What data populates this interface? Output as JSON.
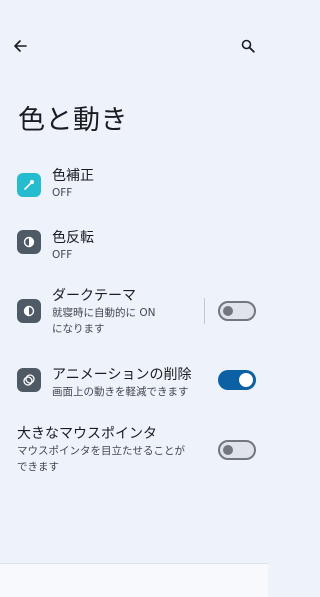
{
  "header": {
    "title": "色と動き"
  },
  "settings": [
    {
      "title": "色補正",
      "subtitle": "OFF"
    },
    {
      "title": "色反転",
      "subtitle": "OFF"
    },
    {
      "title": "ダークテーマ",
      "subtitle_line1": "就寝時に自動的に ON",
      "subtitle_line2": "になります",
      "toggle": "off"
    },
    {
      "title": "アニメーションの削除",
      "subtitle": "画面上の動きを軽減できます",
      "toggle": "on"
    },
    {
      "title": "大きなマウスポインタ",
      "subtitle_line1": "マウスポインタを目立たせることが",
      "subtitle_line2": "できます",
      "toggle": "off"
    }
  ],
  "icons": {
    "back": "arrow-back-icon",
    "search": "search-icon",
    "color_correction": "eyedropper-icon",
    "color_inversion": "invert-colors-icon",
    "dark_theme": "dark-theme-icon",
    "remove_animations": "animation-icon"
  },
  "colors": {
    "accent": "#0b61a4",
    "color_correction_icon_bg": "#25bcd0",
    "tile_icon_bg": "#4e5a66",
    "background": "#eef2fb"
  }
}
